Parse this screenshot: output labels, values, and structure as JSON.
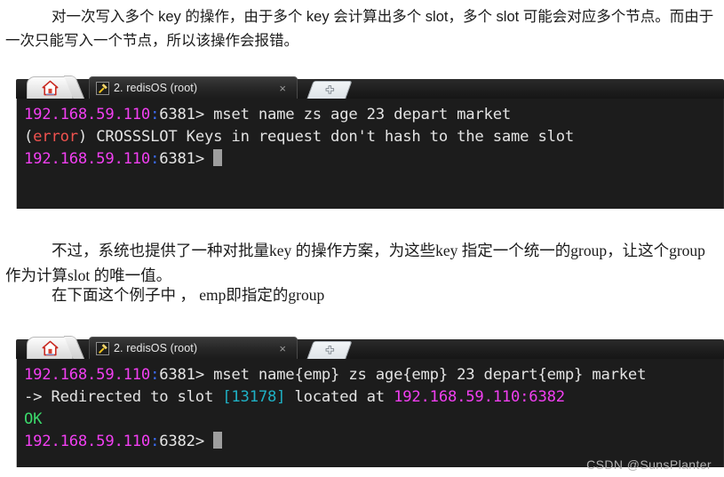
{
  "page": {
    "watermark": "CSDN @SunsPlanter"
  },
  "paragraphs": {
    "p1": "对一次写入多个 key 的操作，由于多个 key 会计算出多个 slot，多个 slot 可能会对应多个节点。而由于一次只能写入一个节点，所以该操作会报错。",
    "p2": "不过，系统也提供了一种对批量key 的操作方案，为这些key 指定一个统一的group，让这个group 作为计算slot 的唯一值。",
    "p3": "在下面这个例子中 ， emp即指定的group"
  },
  "terminals": [
    {
      "tabs": {
        "home_icon": "home-icon",
        "active_tab_icon": "plug-icon",
        "active_tab_title": "2. redisOS (root)",
        "close_label": "×",
        "new_tab_icon": "plus-icon"
      },
      "lines": [
        {
          "segments": [
            {
              "text": "192.168.59.110",
              "color_class": "c-prompt-ip"
            },
            {
              "text": ":",
              "color_class": "c-colon"
            },
            {
              "text": "6381> ",
              "color_class": "c-port"
            },
            {
              "text": "mset name zs age 23 depart market",
              "color_class": "c-default"
            }
          ]
        },
        {
          "segments": [
            {
              "text": "(",
              "color_class": "c-paren"
            },
            {
              "text": "error",
              "color_class": "c-error"
            },
            {
              "text": ") CROSSSLOT Keys in request don't hash to the same slot",
              "color_class": "c-default"
            }
          ]
        },
        {
          "segments": [
            {
              "text": "192.168.59.110",
              "color_class": "c-prompt-ip"
            },
            {
              "text": ":",
              "color_class": "c-colon"
            },
            {
              "text": "6381> ",
              "color_class": "c-port"
            }
          ],
          "cursor": true
        }
      ]
    },
    {
      "tabs": {
        "home_icon": "home-icon",
        "active_tab_icon": "plug-icon",
        "active_tab_title": "2. redisOS (root)",
        "close_label": "×",
        "new_tab_icon": "plus-icon"
      },
      "lines": [
        {
          "segments": [
            {
              "text": "192.168.59.110",
              "color_class": "c-prompt-ip"
            },
            {
              "text": ":",
              "color_class": "c-colon"
            },
            {
              "text": "6381> ",
              "color_class": "c-port"
            },
            {
              "text": "mset name{emp} zs age{emp} 23 depart{emp} market",
              "color_class": "c-default"
            }
          ]
        },
        {
          "segments": [
            {
              "text": "-> Redirected to slot ",
              "color_class": "c-default"
            },
            {
              "text": "[13178]",
              "color_class": "c-slot"
            },
            {
              "text": " located at ",
              "color_class": "c-default"
            },
            {
              "text": "192.168.59.110:6382",
              "color_class": "c-prompt-ip"
            }
          ]
        },
        {
          "segments": [
            {
              "text": "OK",
              "color_class": "c-ok"
            }
          ]
        },
        {
          "segments": [
            {
              "text": "192.168.59.110",
              "color_class": "c-prompt-ip"
            },
            {
              "text": ":",
              "color_class": "c-colon"
            },
            {
              "text": "6382> ",
              "color_class": "c-port"
            }
          ],
          "cursor": true
        }
      ]
    }
  ],
  "colors": {
    "terminal_bg": "#1c1c1c",
    "prompt_ip": "#f13ff1",
    "slot_highlight": "#1fb0c4",
    "error": "#f0524f",
    "ok": "#3bd96b"
  }
}
